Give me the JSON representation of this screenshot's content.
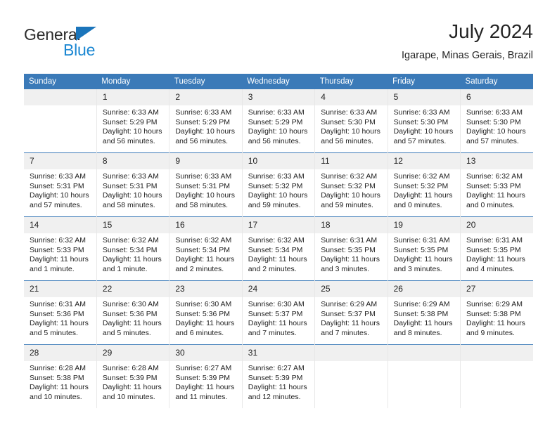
{
  "brand": {
    "name_part1": "General",
    "name_part2": "Blue",
    "triangle_icon": "triangle-icon",
    "accent_color": "#1b75bb",
    "blue_color": "#1b87d2"
  },
  "header": {
    "title": "July 2024",
    "subtitle": "Igarape, Minas Gerais, Brazil"
  },
  "calendar": {
    "header_color": "#3b7ab8",
    "daynum_background": "#f0f0f0",
    "weekday_headers": [
      "Sunday",
      "Monday",
      "Tuesday",
      "Wednesday",
      "Thursday",
      "Friday",
      "Saturday"
    ],
    "weeks": [
      [
        {
          "day": "",
          "empty": true,
          "sunrise": "",
          "sunset": "",
          "daylight_line1": "",
          "daylight_line2": ""
        },
        {
          "day": "1",
          "empty": false,
          "sunrise": "Sunrise: 6:33 AM",
          "sunset": "Sunset: 5:29 PM",
          "daylight_line1": "Daylight: 10 hours",
          "daylight_line2": "and 56 minutes."
        },
        {
          "day": "2",
          "empty": false,
          "sunrise": "Sunrise: 6:33 AM",
          "sunset": "Sunset: 5:29 PM",
          "daylight_line1": "Daylight: 10 hours",
          "daylight_line2": "and 56 minutes."
        },
        {
          "day": "3",
          "empty": false,
          "sunrise": "Sunrise: 6:33 AM",
          "sunset": "Sunset: 5:29 PM",
          "daylight_line1": "Daylight: 10 hours",
          "daylight_line2": "and 56 minutes."
        },
        {
          "day": "4",
          "empty": false,
          "sunrise": "Sunrise: 6:33 AM",
          "sunset": "Sunset: 5:30 PM",
          "daylight_line1": "Daylight: 10 hours",
          "daylight_line2": "and 56 minutes."
        },
        {
          "day": "5",
          "empty": false,
          "sunrise": "Sunrise: 6:33 AM",
          "sunset": "Sunset: 5:30 PM",
          "daylight_line1": "Daylight: 10 hours",
          "daylight_line2": "and 57 minutes."
        },
        {
          "day": "6",
          "empty": false,
          "sunrise": "Sunrise: 6:33 AM",
          "sunset": "Sunset: 5:30 PM",
          "daylight_line1": "Daylight: 10 hours",
          "daylight_line2": "and 57 minutes."
        }
      ],
      [
        {
          "day": "7",
          "empty": false,
          "sunrise": "Sunrise: 6:33 AM",
          "sunset": "Sunset: 5:31 PM",
          "daylight_line1": "Daylight: 10 hours",
          "daylight_line2": "and 57 minutes."
        },
        {
          "day": "8",
          "empty": false,
          "sunrise": "Sunrise: 6:33 AM",
          "sunset": "Sunset: 5:31 PM",
          "daylight_line1": "Daylight: 10 hours",
          "daylight_line2": "and 58 minutes."
        },
        {
          "day": "9",
          "empty": false,
          "sunrise": "Sunrise: 6:33 AM",
          "sunset": "Sunset: 5:31 PM",
          "daylight_line1": "Daylight: 10 hours",
          "daylight_line2": "and 58 minutes."
        },
        {
          "day": "10",
          "empty": false,
          "sunrise": "Sunrise: 6:33 AM",
          "sunset": "Sunset: 5:32 PM",
          "daylight_line1": "Daylight: 10 hours",
          "daylight_line2": "and 59 minutes."
        },
        {
          "day": "11",
          "empty": false,
          "sunrise": "Sunrise: 6:32 AM",
          "sunset": "Sunset: 5:32 PM",
          "daylight_line1": "Daylight: 10 hours",
          "daylight_line2": "and 59 minutes."
        },
        {
          "day": "12",
          "empty": false,
          "sunrise": "Sunrise: 6:32 AM",
          "sunset": "Sunset: 5:32 PM",
          "daylight_line1": "Daylight: 11 hours",
          "daylight_line2": "and 0 minutes."
        },
        {
          "day": "13",
          "empty": false,
          "sunrise": "Sunrise: 6:32 AM",
          "sunset": "Sunset: 5:33 PM",
          "daylight_line1": "Daylight: 11 hours",
          "daylight_line2": "and 0 minutes."
        }
      ],
      [
        {
          "day": "14",
          "empty": false,
          "sunrise": "Sunrise: 6:32 AM",
          "sunset": "Sunset: 5:33 PM",
          "daylight_line1": "Daylight: 11 hours",
          "daylight_line2": "and 1 minute."
        },
        {
          "day": "15",
          "empty": false,
          "sunrise": "Sunrise: 6:32 AM",
          "sunset": "Sunset: 5:34 PM",
          "daylight_line1": "Daylight: 11 hours",
          "daylight_line2": "and 1 minute."
        },
        {
          "day": "16",
          "empty": false,
          "sunrise": "Sunrise: 6:32 AM",
          "sunset": "Sunset: 5:34 PM",
          "daylight_line1": "Daylight: 11 hours",
          "daylight_line2": "and 2 minutes."
        },
        {
          "day": "17",
          "empty": false,
          "sunrise": "Sunrise: 6:32 AM",
          "sunset": "Sunset: 5:34 PM",
          "daylight_line1": "Daylight: 11 hours",
          "daylight_line2": "and 2 minutes."
        },
        {
          "day": "18",
          "empty": false,
          "sunrise": "Sunrise: 6:31 AM",
          "sunset": "Sunset: 5:35 PM",
          "daylight_line1": "Daylight: 11 hours",
          "daylight_line2": "and 3 minutes."
        },
        {
          "day": "19",
          "empty": false,
          "sunrise": "Sunrise: 6:31 AM",
          "sunset": "Sunset: 5:35 PM",
          "daylight_line1": "Daylight: 11 hours",
          "daylight_line2": "and 3 minutes."
        },
        {
          "day": "20",
          "empty": false,
          "sunrise": "Sunrise: 6:31 AM",
          "sunset": "Sunset: 5:35 PM",
          "daylight_line1": "Daylight: 11 hours",
          "daylight_line2": "and 4 minutes."
        }
      ],
      [
        {
          "day": "21",
          "empty": false,
          "sunrise": "Sunrise: 6:31 AM",
          "sunset": "Sunset: 5:36 PM",
          "daylight_line1": "Daylight: 11 hours",
          "daylight_line2": "and 5 minutes."
        },
        {
          "day": "22",
          "empty": false,
          "sunrise": "Sunrise: 6:30 AM",
          "sunset": "Sunset: 5:36 PM",
          "daylight_line1": "Daylight: 11 hours",
          "daylight_line2": "and 5 minutes."
        },
        {
          "day": "23",
          "empty": false,
          "sunrise": "Sunrise: 6:30 AM",
          "sunset": "Sunset: 5:36 PM",
          "daylight_line1": "Daylight: 11 hours",
          "daylight_line2": "and 6 minutes."
        },
        {
          "day": "24",
          "empty": false,
          "sunrise": "Sunrise: 6:30 AM",
          "sunset": "Sunset: 5:37 PM",
          "daylight_line1": "Daylight: 11 hours",
          "daylight_line2": "and 7 minutes."
        },
        {
          "day": "25",
          "empty": false,
          "sunrise": "Sunrise: 6:29 AM",
          "sunset": "Sunset: 5:37 PM",
          "daylight_line1": "Daylight: 11 hours",
          "daylight_line2": "and 7 minutes."
        },
        {
          "day": "26",
          "empty": false,
          "sunrise": "Sunrise: 6:29 AM",
          "sunset": "Sunset: 5:38 PM",
          "daylight_line1": "Daylight: 11 hours",
          "daylight_line2": "and 8 minutes."
        },
        {
          "day": "27",
          "empty": false,
          "sunrise": "Sunrise: 6:29 AM",
          "sunset": "Sunset: 5:38 PM",
          "daylight_line1": "Daylight: 11 hours",
          "daylight_line2": "and 9 minutes."
        }
      ],
      [
        {
          "day": "28",
          "empty": false,
          "sunrise": "Sunrise: 6:28 AM",
          "sunset": "Sunset: 5:38 PM",
          "daylight_line1": "Daylight: 11 hours",
          "daylight_line2": "and 10 minutes."
        },
        {
          "day": "29",
          "empty": false,
          "sunrise": "Sunrise: 6:28 AM",
          "sunset": "Sunset: 5:39 PM",
          "daylight_line1": "Daylight: 11 hours",
          "daylight_line2": "and 10 minutes."
        },
        {
          "day": "30",
          "empty": false,
          "sunrise": "Sunrise: 6:27 AM",
          "sunset": "Sunset: 5:39 PM",
          "daylight_line1": "Daylight: 11 hours",
          "daylight_line2": "and 11 minutes."
        },
        {
          "day": "31",
          "empty": false,
          "sunrise": "Sunrise: 6:27 AM",
          "sunset": "Sunset: 5:39 PM",
          "daylight_line1": "Daylight: 11 hours",
          "daylight_line2": "and 12 minutes."
        },
        {
          "day": "",
          "empty": true,
          "sunrise": "",
          "sunset": "",
          "daylight_line1": "",
          "daylight_line2": ""
        },
        {
          "day": "",
          "empty": true,
          "sunrise": "",
          "sunset": "",
          "daylight_line1": "",
          "daylight_line2": ""
        },
        {
          "day": "",
          "empty": true,
          "sunrise": "",
          "sunset": "",
          "daylight_line1": "",
          "daylight_line2": ""
        }
      ]
    ]
  }
}
